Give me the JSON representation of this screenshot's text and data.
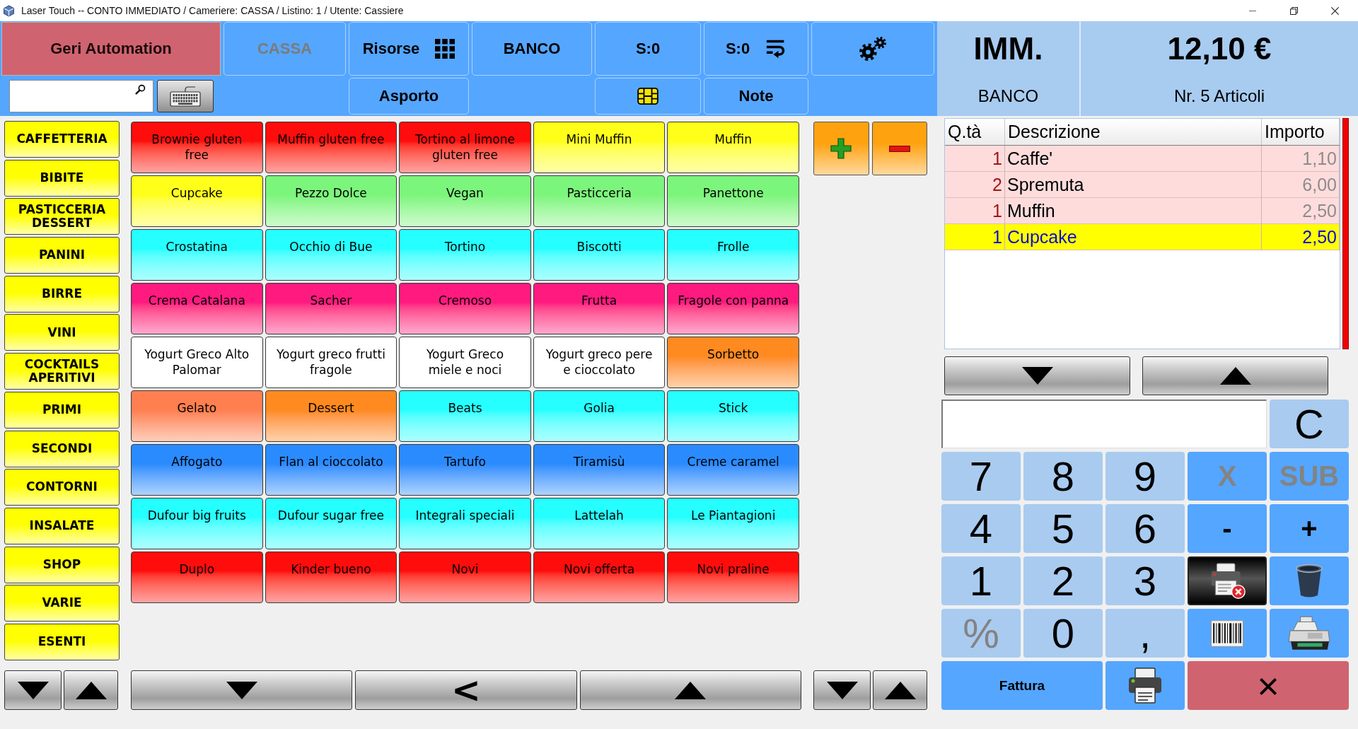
{
  "window": {
    "title": "Laser Touch -- CONTO IMMEDIATO / Cameriere: CASSA / Listino: 1 / Utente: Cassiere"
  },
  "header": {
    "company": "Geri Automation",
    "top_buttons": [
      {
        "label": "CASSA",
        "kind": "text",
        "disabled": true
      },
      {
        "label": "Risorse",
        "kind": "apps",
        "disabled": false
      },
      {
        "label": "BANCO",
        "kind": "text",
        "disabled": false
      },
      {
        "label": "S:0",
        "kind": "text",
        "disabled": false
      },
      {
        "label": "S:0",
        "kind": "wrap",
        "disabled": false
      },
      {
        "kind": "settings",
        "disabled": false
      }
    ],
    "bottom_buttons": [
      {
        "label": "Asporto",
        "kind": "text",
        "disabled": false
      },
      {
        "kind": "card",
        "disabled": false
      },
      {
        "label": "Note",
        "kind": "text",
        "disabled": false
      }
    ],
    "summary": {
      "mode": "IMM.",
      "location": "BANCO",
      "total": "12,10 €",
      "items": "Nr. 5 Articoli"
    }
  },
  "categories": [
    "CAFFETTERIA",
    "BIBITE",
    "PASTICCERIA DESSERT",
    "PANINI",
    "BIRRE",
    "VINI",
    "COCKTAILS APERITIVI",
    "PRIMI",
    "SECONDI",
    "CONTORNI",
    "INSALATE",
    "SHOP",
    "VARIE",
    "ESENTI"
  ],
  "products": [
    {
      "label": "Brownie gluten free",
      "color": "#ff0d0d"
    },
    {
      "label": "Muffin gluten free",
      "color": "#ff0d0d"
    },
    {
      "label": "Tortino al limone gluten free",
      "color": "#ff0d0d"
    },
    {
      "label": "Mini Muffin",
      "color": "#ffff1a"
    },
    {
      "label": "Muffin",
      "color": "#ffff1a"
    },
    {
      "label": "Cupcake",
      "color": "#ffff1a"
    },
    {
      "label": "Pezzo Dolce",
      "color": "#7cf57c"
    },
    {
      "label": "Vegan",
      "color": "#7cf57c"
    },
    {
      "label": "Pasticceria",
      "color": "#7cf57c"
    },
    {
      "label": "Panettone",
      "color": "#7cf57c"
    },
    {
      "label": "Crostatina",
      "color": "#26ffff"
    },
    {
      "label": "Occhio di Bue",
      "color": "#26ffff"
    },
    {
      "label": "Tortino",
      "color": "#26ffff"
    },
    {
      "label": "Biscotti",
      "color": "#26ffff"
    },
    {
      "label": "Frolle",
      "color": "#26ffff"
    },
    {
      "label": "Crema Catalana",
      "color": "#ff1a80"
    },
    {
      "label": "Sacher",
      "color": "#ff1a80"
    },
    {
      "label": "Cremoso",
      "color": "#ff1a80"
    },
    {
      "label": "Frutta",
      "color": "#ff1a80"
    },
    {
      "label": "Fragole con panna",
      "color": "#ff1a80"
    },
    {
      "label": "Yogurt Greco Alto Palomar",
      "color": "#ffffff"
    },
    {
      "label": "Yogurt greco frutti fragole",
      "color": "#ffffff"
    },
    {
      "label": "Yogurt Greco miele e noci",
      "color": "#ffffff"
    },
    {
      "label": "Yogurt greco pere e cioccolato",
      "color": "#ffffff"
    },
    {
      "label": "Sorbetto",
      "color": "#ff8a1f"
    },
    {
      "label": "Gelato",
      "color": "#ff7f50"
    },
    {
      "label": "Dessert",
      "color": "#ff8a1f"
    },
    {
      "label": "Beats",
      "color": "#26ffff"
    },
    {
      "label": "Golia",
      "color": "#26ffff"
    },
    {
      "label": "Stick",
      "color": "#26ffff"
    },
    {
      "label": "Affogato",
      "color": "#2a8bff"
    },
    {
      "label": "Flan al cioccolato",
      "color": "#2a8bff"
    },
    {
      "label": "Tartufo",
      "color": "#2a8bff"
    },
    {
      "label": "Tiramisù",
      "color": "#2a8bff"
    },
    {
      "label": "Creme caramel",
      "color": "#2a8bff"
    },
    {
      "label": "Dufour big fruits",
      "color": "#26ffff"
    },
    {
      "label": "Dufour sugar free",
      "color": "#26ffff"
    },
    {
      "label": "Integrali speciali",
      "color": "#26ffff"
    },
    {
      "label": "Lattelah",
      "color": "#26ffff"
    },
    {
      "label": "Le Piantagioni",
      "color": "#26ffff"
    },
    {
      "label": "Duplo",
      "color": "#ff0d0d"
    },
    {
      "label": "Kinder bueno",
      "color": "#ff0d0d"
    },
    {
      "label": "Novi",
      "color": "#ff0d0d"
    },
    {
      "label": "Novi offerta",
      "color": "#ff0d0d"
    },
    {
      "label": "Novi praline",
      "color": "#ff0d0d"
    }
  ],
  "product_nav": {
    "back": "<"
  },
  "order": {
    "columns": [
      "Q.tà",
      "Descrizione",
      "Importo"
    ],
    "rows": [
      {
        "qty": "1",
        "description": "Caffe'",
        "amount": "1,10",
        "selected": false
      },
      {
        "qty": "2",
        "description": "Spremuta",
        "amount": "6,00",
        "selected": false
      },
      {
        "qty": "1",
        "description": "Muffin",
        "amount": "2,50",
        "selected": false
      },
      {
        "qty": "1",
        "description": "Cupcake",
        "amount": "2,50",
        "selected": true
      }
    ]
  },
  "keypad": {
    "keys": [
      {
        "label": "C",
        "kind": "clear",
        "disabled": false
      },
      {
        "label": "7",
        "kind": "digit",
        "disabled": false
      },
      {
        "label": "8",
        "kind": "digit",
        "disabled": false
      },
      {
        "label": "9",
        "kind": "digit",
        "disabled": false
      },
      {
        "label": "X",
        "kind": "function",
        "disabled": true
      },
      {
        "label": "SUB",
        "kind": "function",
        "disabled": true
      },
      {
        "label": "4",
        "kind": "digit",
        "disabled": false
      },
      {
        "label": "5",
        "kind": "digit",
        "disabled": false
      },
      {
        "label": "6",
        "kind": "digit",
        "disabled": false
      },
      {
        "label": "-",
        "kind": "function",
        "disabled": false
      },
      {
        "label": "+",
        "kind": "function",
        "disabled": false
      },
      {
        "label": "1",
        "kind": "digit",
        "disabled": false
      },
      {
        "label": "2",
        "kind": "digit",
        "disabled": false
      },
      {
        "label": "3",
        "kind": "digit",
        "disabled": false
      },
      {
        "kind": "void",
        "disabled": false
      },
      {
        "kind": "delete",
        "disabled": false
      },
      {
        "label": "%",
        "kind": "digit",
        "disabled": true
      },
      {
        "label": "0",
        "kind": "digit",
        "disabled": false
      },
      {
        "label": ",",
        "kind": "digit",
        "disabled": false
      },
      {
        "kind": "scan",
        "disabled": false
      },
      {
        "kind": "checkout",
        "disabled": false
      },
      {
        "label": "Fattura",
        "kind": "invoice",
        "disabled": false
      },
      {
        "kind": "print",
        "disabled": false
      },
      {
        "label": "×",
        "kind": "cancel",
        "disabled": false
      }
    ]
  }
}
